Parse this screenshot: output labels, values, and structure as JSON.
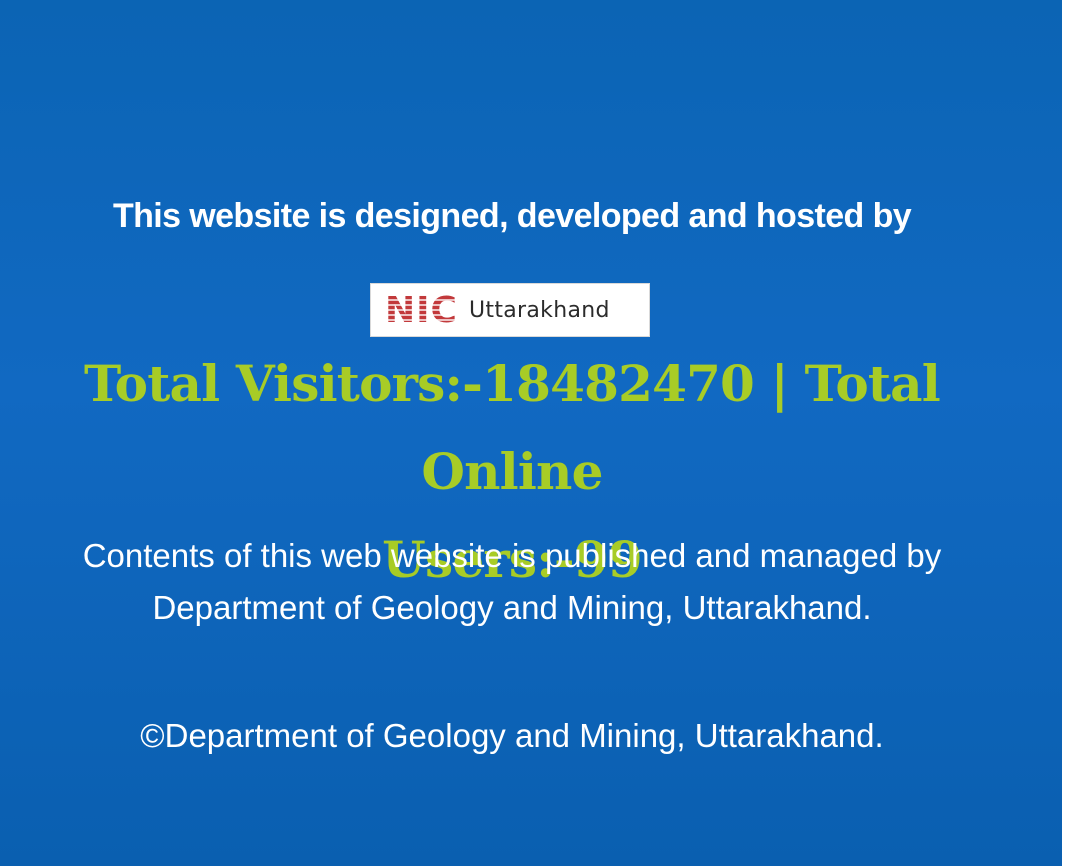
{
  "footer": {
    "hosted_by_text": "This website is designed, developed and hosted by",
    "logo": {
      "mark": "NIC",
      "label": "Uttarakhand",
      "mark_color": "#c2393b"
    },
    "counter": {
      "line1": "Total Visitors:-18482470 | Total Online",
      "line2": "Users:-99",
      "color": "#a8cc26"
    },
    "contents_line1": "Contents of this web website is published and managed by",
    "contents_line2": "Department of Geology and Mining, Uttarakhand.",
    "copyright": "©Department of Geology and Mining, Uttarakhand.",
    "background_color": "#0b64b4"
  }
}
